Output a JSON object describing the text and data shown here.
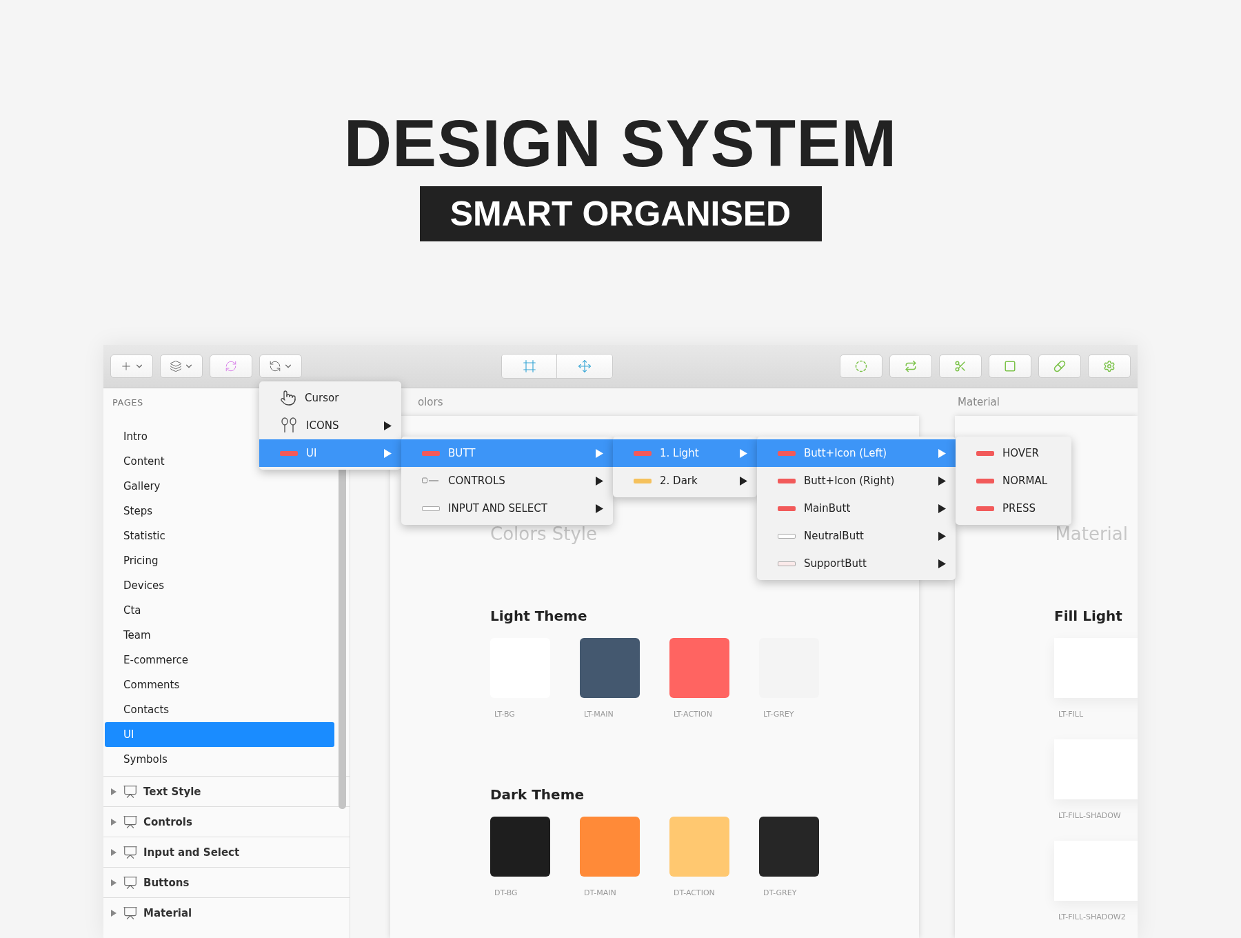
{
  "header": {
    "title": "DESIGN SYSTEM",
    "subtitle": "SMART ORGANISED"
  },
  "sidebar": {
    "heading": "PAGES",
    "pages": [
      {
        "label": "Intro",
        "selected": false
      },
      {
        "label": "Content",
        "selected": false
      },
      {
        "label": "Gallery",
        "selected": false
      },
      {
        "label": "Steps",
        "selected": false
      },
      {
        "label": "Statistic",
        "selected": false
      },
      {
        "label": "Pricing",
        "selected": false
      },
      {
        "label": "Devices",
        "selected": false
      },
      {
        "label": "Cta",
        "selected": false
      },
      {
        "label": "Team",
        "selected": false
      },
      {
        "label": "E-commerce",
        "selected": false
      },
      {
        "label": "Comments",
        "selected": false
      },
      {
        "label": "Contacts",
        "selected": false
      },
      {
        "label": "UI",
        "selected": true
      },
      {
        "label": "Symbols",
        "selected": false
      }
    ],
    "groups": [
      {
        "label": "Text Style",
        "expanded": false
      },
      {
        "label": "Controls",
        "expanded": false
      },
      {
        "label": "Input and Select",
        "expanded": false
      },
      {
        "label": "Buttons",
        "expanded": false
      },
      {
        "label": "Material",
        "expanded": false
      }
    ]
  },
  "menus": [
    {
      "items": [
        {
          "kind": "hand",
          "label": "Cursor",
          "submenu": false,
          "selected": false
        },
        {
          "kind": "earbuds",
          "label": "ICONS",
          "submenu": true,
          "selected": false
        },
        {
          "kind": "swatch",
          "color": "#f25a5a",
          "label": "UI",
          "submenu": true,
          "selected": true
        }
      ]
    },
    {
      "items": [
        {
          "kind": "swatch",
          "color": "#f25a5a",
          "label": "BUTT",
          "submenu": true,
          "selected": true
        },
        {
          "kind": "control",
          "label": "CONTROLS",
          "submenu": true,
          "selected": false
        },
        {
          "kind": "swatch",
          "color": "#ffffff",
          "label": "INPUT AND SELECT",
          "submenu": true,
          "selected": false
        }
      ]
    },
    {
      "items": [
        {
          "kind": "swatch",
          "color": "#f25a5a",
          "label": "1. Light",
          "submenu": true,
          "selected": true
        },
        {
          "kind": "swatch",
          "color": "#f5c15c",
          "label": "2. Dark",
          "submenu": true,
          "selected": false
        }
      ]
    },
    {
      "items": [
        {
          "kind": "swatch",
          "color": "#f25a5a",
          "label": "Butt+Icon (Left)",
          "submenu": true,
          "selected": true
        },
        {
          "kind": "swatch",
          "color": "#f25a5a",
          "label": "Butt+Icon (Right)",
          "submenu": true,
          "selected": false
        },
        {
          "kind": "swatch",
          "color": "#f25a5a",
          "label": "MainButt",
          "submenu": true,
          "selected": false
        },
        {
          "kind": "swatch",
          "color": "#ffffff",
          "label": "NeutralButt",
          "submenu": true,
          "selected": false
        },
        {
          "kind": "swatch",
          "color": "#fbeaea",
          "label": "SupportButt",
          "submenu": true,
          "selected": false
        }
      ]
    },
    {
      "items": [
        {
          "kind": "swatch",
          "color": "#f25a5a",
          "label": "HOVER",
          "submenu": false,
          "selected": false
        },
        {
          "kind": "swatch",
          "color": "#f25a5a",
          "label": "NORMAL",
          "submenu": false,
          "selected": false
        },
        {
          "kind": "swatch",
          "color": "#f25a5a",
          "label": "PRESS",
          "submenu": false,
          "selected": false
        }
      ]
    }
  ],
  "artboards": [
    {
      "label": "olors",
      "title": "Colors Style",
      "sections": [
        {
          "heading": "Light Theme",
          "swatches": [
            {
              "name": "LT-BG",
              "color": "#ffffff"
            },
            {
              "name": "LT-MAIN",
              "color": "#44586f"
            },
            {
              "name": "LT-ACTION",
              "color": "#ff6461"
            },
            {
              "name": "LT-GREY",
              "color": "#f4f4f4"
            }
          ]
        },
        {
          "heading": "Dark Theme",
          "swatches": [
            {
              "name": "DT-BG",
              "color": "#1e1e1e"
            },
            {
              "name": "DT-MAIN",
              "color": "#ff8a38"
            },
            {
              "name": "DT-ACTION",
              "color": "#ffc870"
            },
            {
              "name": "DT-GREY",
              "color": "#262626"
            }
          ]
        }
      ]
    },
    {
      "label": "Material",
      "title": "Material",
      "sections": [
        {
          "heading": "Fill Light",
          "swatches": [
            {
              "name": "LT-FILL",
              "color": "#ffffff"
            },
            {
              "name": "LT-FILL-SHADOW",
              "color": "#ffffff"
            },
            {
              "name": "LT-FILL-SHADOW2",
              "color": "#ffffff"
            }
          ]
        }
      ]
    }
  ]
}
